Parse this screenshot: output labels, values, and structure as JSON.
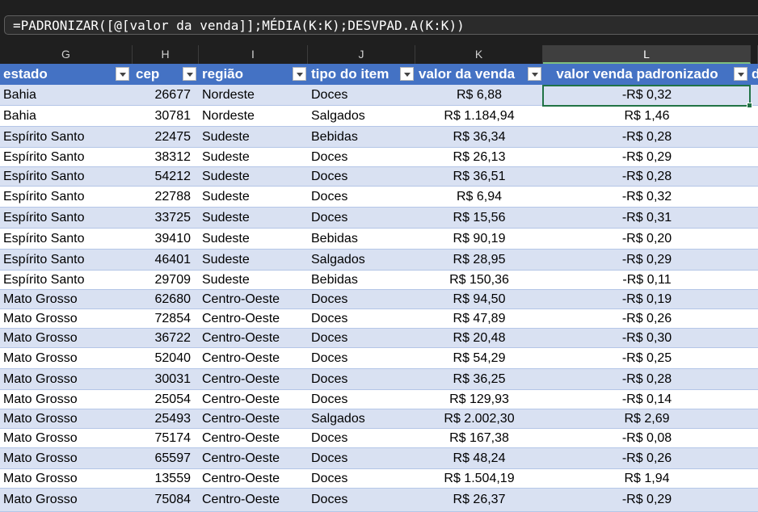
{
  "formula_bar": {
    "formula": "=PADRONIZAR([@[valor da venda]];MÉDIA(K:K);DESVPAD.A(K:K))"
  },
  "column_letters": [
    "G",
    "H",
    "I",
    "J",
    "K",
    "L"
  ],
  "selected_column": "L",
  "table": {
    "headers": [
      "estado",
      "cep",
      "região",
      "tipo do item",
      "valor da venda",
      "valor venda padronizado"
    ],
    "overflow_header_fragment": "d",
    "rows": [
      [
        "Bahia",
        "26677",
        "Nordeste",
        "Doces",
        "R$ 6,88",
        "-R$ 0,32"
      ],
      [
        "Bahia",
        "30781",
        "Nordeste",
        "Salgados",
        "R$ 1.184,94",
        "R$ 1,46"
      ],
      [
        "Espírito Santo",
        "22475",
        "Sudeste",
        "Bebidas",
        "R$ 36,34",
        "-R$ 0,28"
      ],
      [
        "Espírito Santo",
        "38312",
        "Sudeste",
        "Doces",
        "R$ 26,13",
        "-R$ 0,29"
      ],
      [
        "Espírito Santo",
        "54212",
        "Sudeste",
        "Doces",
        "R$ 36,51",
        "-R$ 0,28"
      ],
      [
        "Espírito Santo",
        "22788",
        "Sudeste",
        "Doces",
        "R$ 6,94",
        "-R$ 0,32"
      ],
      [
        "Espírito Santo",
        "33725",
        "Sudeste",
        "Doces",
        "R$ 15,56",
        "-R$ 0,31"
      ],
      [
        "Espírito Santo",
        "39410",
        "Sudeste",
        "Bebidas",
        "R$ 90,19",
        "-R$ 0,20"
      ],
      [
        "Espírito Santo",
        "46401",
        "Sudeste",
        "Salgados",
        "R$ 28,95",
        "-R$ 0,29"
      ],
      [
        "Espírito Santo",
        "29709",
        "Sudeste",
        "Bebidas",
        "R$ 150,36",
        "-R$ 0,11"
      ],
      [
        "Mato Grosso",
        "62680",
        "Centro-Oeste",
        "Doces",
        "R$ 94,50",
        "-R$ 0,19"
      ],
      [
        "Mato Grosso",
        "72854",
        "Centro-Oeste",
        "Doces",
        "R$ 47,89",
        "-R$ 0,26"
      ],
      [
        "Mato Grosso",
        "36722",
        "Centro-Oeste",
        "Doces",
        "R$ 20,48",
        "-R$ 0,30"
      ],
      [
        "Mato Grosso",
        "52040",
        "Centro-Oeste",
        "Doces",
        "R$ 54,29",
        "-R$ 0,25"
      ],
      [
        "Mato Grosso",
        "30031",
        "Centro-Oeste",
        "Doces",
        "R$ 36,25",
        "-R$ 0,28"
      ],
      [
        "Mato Grosso",
        "25054",
        "Centro-Oeste",
        "Doces",
        "R$ 129,93",
        "-R$ 0,14"
      ],
      [
        "Mato Grosso",
        "25493",
        "Centro-Oeste",
        "Salgados",
        "R$ 2.002,30",
        "R$ 2,69"
      ],
      [
        "Mato Grosso",
        "75174",
        "Centro-Oeste",
        "Doces",
        "R$ 167,38",
        "-R$ 0,08"
      ],
      [
        "Mato Grosso",
        "65597",
        "Centro-Oeste",
        "Doces",
        "R$ 48,24",
        "-R$ 0,26"
      ],
      [
        "Mato Grosso",
        "13559",
        "Centro-Oeste",
        "Doces",
        "R$ 1.504,19",
        "R$ 1,94"
      ],
      [
        "Mato Grosso",
        "75084",
        "Centro-Oeste",
        "Doces",
        "R$ 26,37",
        "-R$ 0,29"
      ]
    ]
  },
  "colors": {
    "header_fill": "#4472c4",
    "band_fill": "#d9e1f2",
    "selection_border": "#217346",
    "dark_chrome": "#1f1f1f"
  },
  "icons": {
    "filter_dropdown": "chevron-down-icon"
  }
}
